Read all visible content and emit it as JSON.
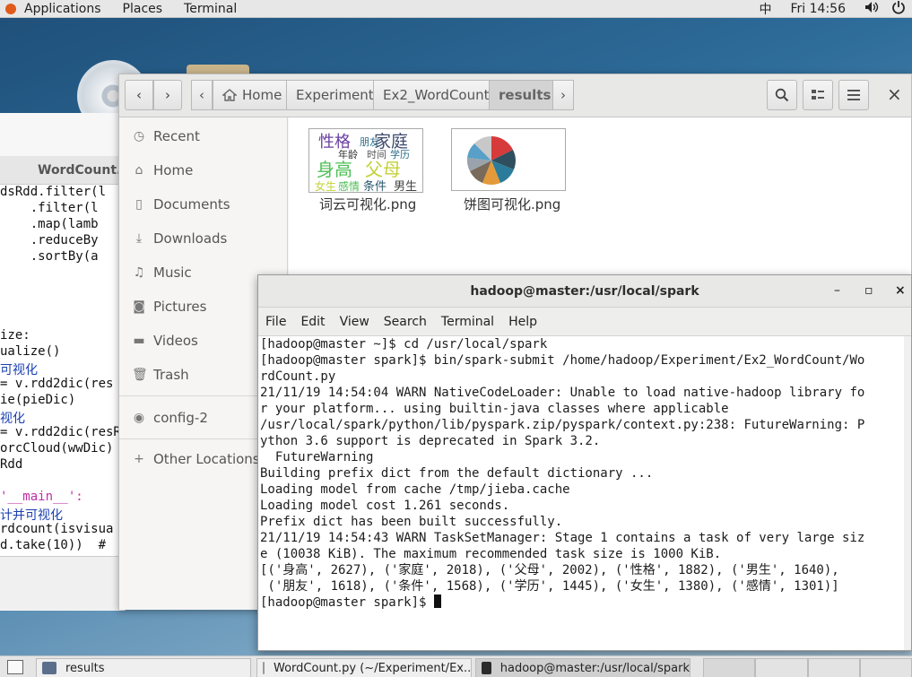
{
  "topbar": {
    "applications": "Applications",
    "places": "Places",
    "terminal": "Terminal",
    "input_method": "中",
    "clock": "Fri 14:56"
  },
  "editor": {
    "tab_label": "WordCount.p",
    "lines": [
      "dsRdd.filter(l",
      "    .filter(l",
      "    .map(lamb",
      "    .reduceBy",
      "    .sortBy(a",
      "",
      "",
      "ize:",
      "ualize()",
      "可视化",
      "= v.rdd2dic(res",
      "ie(pieDic)",
      "视化",
      "= v.rdd2dic(resR",
      "orcCloud(wwDic)",
      "Rdd",
      "",
      "'__main__':",
      "计并可视化",
      "rdcount(isvisua",
      "d.take(10))  #"
    ]
  },
  "files": {
    "nav": {
      "back": "‹",
      "forward": "›",
      "crumbs": [
        "Home",
        "Experiment",
        "Ex2_WordCount",
        "results"
      ],
      "search_icon": "search-icon",
      "view_icon": "view-grid-icon",
      "menu_icon": "hamburger-icon",
      "close": "×"
    },
    "sidebar": [
      {
        "label": "Recent",
        "icon": "clock-icon"
      },
      {
        "label": "Home",
        "icon": "home-icon"
      },
      {
        "label": "Documents",
        "icon": "document-icon"
      },
      {
        "label": "Downloads",
        "icon": "download-icon"
      },
      {
        "label": "Music",
        "icon": "music-icon"
      },
      {
        "label": "Pictures",
        "icon": "camera-icon"
      },
      {
        "label": "Videos",
        "icon": "video-icon"
      },
      {
        "label": "Trash",
        "icon": "trash-icon"
      },
      {
        "label": "config-2",
        "icon": "disc-icon"
      },
      {
        "label": "Other Locations",
        "icon": "plus-icon"
      }
    ],
    "items": [
      {
        "name": "词云可视化.png",
        "words": [
          "性格",
          "家庭",
          "身高",
          "父母",
          "年龄",
          "朋友",
          "学历",
          "女生",
          "感情",
          "条件",
          "男生",
          "时间"
        ]
      },
      {
        "name": "饼图可视化.png"
      }
    ]
  },
  "terminal": {
    "title": "hadoop@master:/usr/local/spark",
    "menu": [
      "File",
      "Edit",
      "View",
      "Search",
      "Terminal",
      "Help"
    ],
    "lines": [
      "[hadoop@master ~]$ cd /usr/local/spark",
      "[hadoop@master spark]$ bin/spark-submit /home/hadoop/Experiment/Ex2_WordCount/Wo",
      "rdCount.py",
      "21/11/19 14:54:04 WARN NativeCodeLoader: Unable to load native-hadoop library fo",
      "r your platform... using builtin-java classes where applicable",
      "/usr/local/spark/python/lib/pyspark.zip/pyspark/context.py:238: FutureWarning: P",
      "ython 3.6 support is deprecated in Spark 3.2.",
      "  FutureWarning",
      "Building prefix dict from the default dictionary ...",
      "Loading model from cache /tmp/jieba.cache",
      "Loading model cost 1.261 seconds.",
      "Prefix dict has been built successfully.",
      "21/11/19 14:54:43 WARN TaskSetManager: Stage 1 contains a task of very large siz",
      "e (10038 KiB). The maximum recommended task size is 1000 KiB.",
      "[('身高', 2627), ('家庭', 2018), ('父母', 2002), ('性格', 1882), ('男生', 1640),",
      " ('朋友', 1618), ('条件', 1568), ('学历', 1445), ('女生', 1380), ('感情', 1301)]"
    ],
    "prompt": "[hadoop@master spark]$ "
  },
  "taskbar": {
    "items": [
      {
        "label": "results"
      },
      {
        "label": "WordCount.py (~/Experiment/Ex..."
      },
      {
        "label": "hadoop@master:/usr/local/spark"
      }
    ]
  }
}
